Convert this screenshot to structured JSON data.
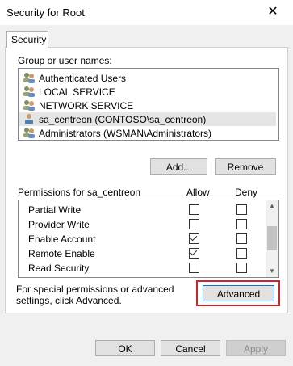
{
  "window": {
    "title": "Security for Root",
    "close_glyph": "✕"
  },
  "tabs": [
    {
      "label": "Security"
    }
  ],
  "group_label": "Group or user names:",
  "users": [
    {
      "name": "Authenticated Users",
      "icon": "users-icon"
    },
    {
      "name": "LOCAL SERVICE",
      "icon": "users-icon"
    },
    {
      "name": "NETWORK SERVICE",
      "icon": "users-icon"
    },
    {
      "name": "sa_centreon (CONTOSO\\sa_centreon)",
      "icon": "user-icon",
      "selected": true
    },
    {
      "name": "Administrators (WSMAN\\Administrators)",
      "icon": "users-icon"
    }
  ],
  "buttons": {
    "add": "Add...",
    "remove": "Remove",
    "advanced": "Advanced",
    "ok": "OK",
    "cancel": "Cancel",
    "apply": "Apply"
  },
  "permissions": {
    "header": "Permissions for sa_centreon",
    "allow_label": "Allow",
    "deny_label": "Deny",
    "rows": [
      {
        "name": "Partial Write",
        "allow": false,
        "deny": false
      },
      {
        "name": "Provider Write",
        "allow": false,
        "deny": false
      },
      {
        "name": "Enable Account",
        "allow": true,
        "deny": false
      },
      {
        "name": "Remote Enable",
        "allow": true,
        "deny": false
      },
      {
        "name": "Read Security",
        "allow": false,
        "deny": false
      }
    ]
  },
  "advanced_note": "For special permissions or advanced settings, click Advanced.",
  "colors": {
    "highlight_box": "#d2232a",
    "primary_border": "#0078d7"
  }
}
